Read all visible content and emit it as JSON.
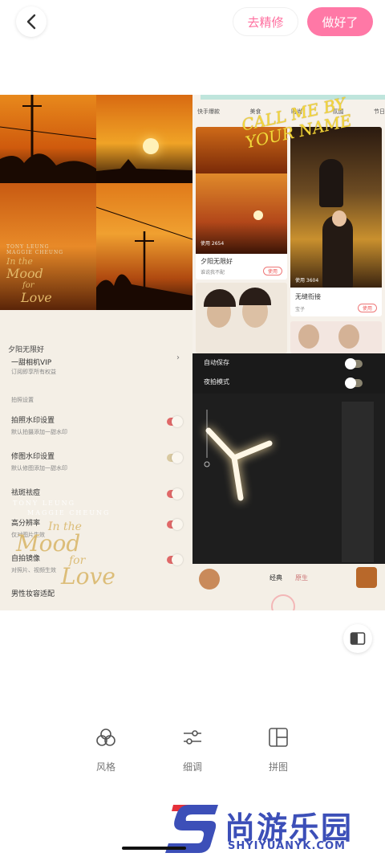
{
  "topbar": {
    "refine_label": "去精修",
    "done_label": "做好了"
  },
  "collage": {
    "sunset_poster": {
      "names_line1": "TONY LEUNG",
      "names_line2": "MAGGIE CHEUNG",
      "title": [
        "In the",
        "Mood",
        "for",
        "Love"
      ]
    },
    "settings_panel": {
      "vip_title": "夕阳无限好",
      "vip_subtitle": "一甜相机VIP",
      "vip_hint": "订阅即享所有权益",
      "section_header": "拍照设置",
      "items": [
        {
          "title": "拍照水印设置",
          "sub": "默认拍摄添加一甜水印",
          "on": true
        },
        {
          "title": "修图水印设置",
          "sub": "默认修图添加一甜水印",
          "on": false
        },
        {
          "title": "祛斑祛痘",
          "sub": "",
          "on": true
        },
        {
          "title": "高分辨率",
          "sub": "仅对图片生效",
          "on": true
        },
        {
          "title": "自拍镜像",
          "sub": "对照片、视频生效",
          "on": true
        },
        {
          "title": "男性妆容适配",
          "sub": "",
          "on": false
        }
      ],
      "overlay_names_line1": "TONY LEUNG",
      "overlay_names_line2": "MAGGIE CHEUNG",
      "overlay_title": [
        "In the",
        "Mood",
        "for",
        "Love"
      ]
    },
    "app_grid": {
      "tabs": [
        "快手爆款",
        "美食",
        "时尚",
        "氛围",
        "节日"
      ],
      "callme_text": "CALL ME BY YOUR NAME",
      "cards": [
        {
          "caption": "夕阳无限好",
          "meta": "谁说我不配",
          "uses": "使用 2654",
          "use_label": "使用"
        },
        {
          "caption": "无缝衔接",
          "meta": "宝子",
          "uses": "使用 3604",
          "use_label": "使用"
        }
      ]
    },
    "camera": {
      "auto_save": "自动保存",
      "night_mode": "夜拍模式",
      "mode_classic": "经典",
      "mode_original": "原生"
    }
  },
  "bottom_toolbar": {
    "tools": [
      {
        "label": "风格",
        "icon": "style-icon"
      },
      {
        "label": "细调",
        "icon": "adjust-icon"
      },
      {
        "label": "拼图",
        "icon": "collage-icon"
      }
    ]
  },
  "watermark": {
    "name": "尚游乐园",
    "url": "SHYIYUANYK.COM"
  },
  "colors": {
    "accent_pink": "#ff78a6",
    "watermark_blue": "#3c4fb8",
    "watermark_red": "#e5303a"
  }
}
